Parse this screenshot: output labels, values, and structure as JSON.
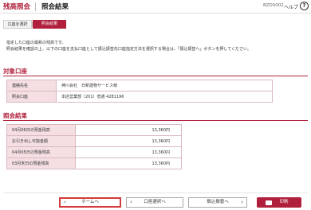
{
  "header": {
    "brand": "残高照会",
    "page_title": "照会結果",
    "screen_id": "BZDS002",
    "help_label": "ヘルプ",
    "help_icon": "?"
  },
  "steps": [
    {
      "label": "口座を選択"
    },
    {
      "label": "照会結果"
    }
  ],
  "instruction": {
    "line1": "指定した口座の最新の残高です。",
    "line2": "照会結果を確認の上、以下の口座を支払口座として振込振替先口座指定方法を選択する場合は、「振込振替へ」ボタンを押してください。"
  },
  "account_section": {
    "title": "対象口座",
    "rows": [
      {
        "label": "連絡先名",
        "value": "神川会社　日新建物サービス様"
      },
      {
        "label": "照会口座",
        "value": "本店営業部（201）普通 4281196"
      }
    ]
  },
  "result_section": {
    "title": "照会結果",
    "rows": [
      {
        "label": "04月06日の預金残高",
        "value": "13,360円"
      },
      {
        "label": "お引き出し可能金額",
        "value": "13,360円"
      },
      {
        "label": "04月05日の預金残高",
        "value": "13,360円"
      },
      {
        "label": "03月末日の預金残高",
        "value": "13,360円"
      }
    ]
  },
  "buttons": {
    "home": "ホームへ",
    "reselect": "口座選択へ",
    "transfer": "振込振替へ",
    "print": "印刷"
  },
  "colors": {
    "accent": "#b0203c",
    "label_bg": "#f5dfe3",
    "home_highlight": "#d43a3a"
  }
}
